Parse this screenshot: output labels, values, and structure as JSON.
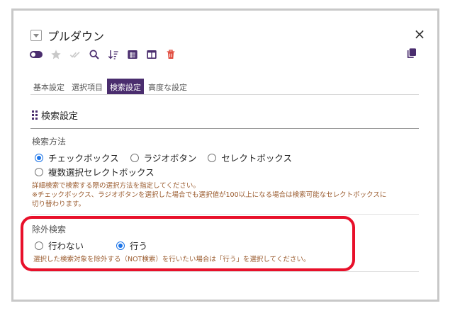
{
  "dialog": {
    "title": "プルダウン",
    "close_glyph": "×"
  },
  "toolbar": {
    "icons": [
      "toggle-icon",
      "star-icon",
      "double-check-icon",
      "search-icon",
      "sort-icon",
      "list-icon",
      "columns-icon",
      "trash-icon",
      "copy-icon"
    ],
    "colors": {
      "accent": "#4a2d6e",
      "muted": "#c9c9c9",
      "danger": "#e0483a"
    }
  },
  "tabs": [
    {
      "label": "基本設定",
      "active": false
    },
    {
      "label": "選択項目",
      "active": false
    },
    {
      "label": "検索設定",
      "active": true
    },
    {
      "label": "高度な設定",
      "active": false
    }
  ],
  "section": {
    "title": "検索設定"
  },
  "search_method": {
    "label": "検索方法",
    "options": [
      {
        "label": "チェックボックス",
        "selected": true
      },
      {
        "label": "ラジオボタン",
        "selected": false
      },
      {
        "label": "セレクトボックス",
        "selected": false
      },
      {
        "label": "複数選択セレクトボックス",
        "selected": false
      }
    ],
    "help": [
      "詳細検索で検索する際の選択方法を指定してください。",
      "※チェックボックス、ラジオボタンを選択した場合でも選択値が100以上になる場合は検索可能なセレクトボックスに",
      "切り替わります。"
    ]
  },
  "exclude_search": {
    "label": "除外検索",
    "options": [
      {
        "label": "行わない",
        "selected": false
      },
      {
        "label": "行う",
        "selected": true
      }
    ],
    "help": "選択した検索対象を除外する（NOT検索）を行いたい場合は「行う」を選択してください。"
  },
  "highlight_color": "#e8102a"
}
